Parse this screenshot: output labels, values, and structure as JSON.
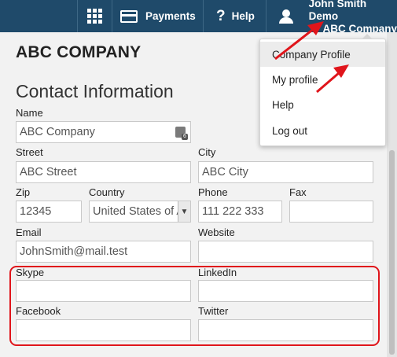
{
  "topbar": {
    "payments_label": "Payments",
    "help_label": "Help",
    "help_glyph": "?",
    "user_name": "John Smith Demo",
    "user_company": "ABC Company"
  },
  "dropdown": {
    "items": [
      {
        "label": "Company Profile",
        "hover": true
      },
      {
        "label": "My profile"
      },
      {
        "label": "Help"
      },
      {
        "label": "Log out"
      }
    ]
  },
  "page": {
    "company_title": "ABC COMPANY",
    "section_title": "Contact Information"
  },
  "form": {
    "name": {
      "label": "Name",
      "value": "ABC Company"
    },
    "street": {
      "label": "Street",
      "value": "ABC Street"
    },
    "city": {
      "label": "City",
      "value": "ABC City"
    },
    "zip": {
      "label": "Zip",
      "value": "12345"
    },
    "country": {
      "label": "Country",
      "value": "United States of America"
    },
    "phone": {
      "label": "Phone",
      "value": "111 222 333"
    },
    "fax": {
      "label": "Fax",
      "value": ""
    },
    "email": {
      "label": "Email",
      "value": "JohnSmith@mail.test"
    },
    "website": {
      "label": "Website",
      "value": ""
    },
    "skype": {
      "label": "Skype",
      "value": ""
    },
    "linkedin": {
      "label": "LinkedIn",
      "value": ""
    },
    "facebook": {
      "label": "Facebook",
      "value": ""
    },
    "twitter": {
      "label": "Twitter",
      "value": ""
    }
  },
  "colors": {
    "topbar": "#1f4a6a",
    "annotation": "#e0151b"
  }
}
